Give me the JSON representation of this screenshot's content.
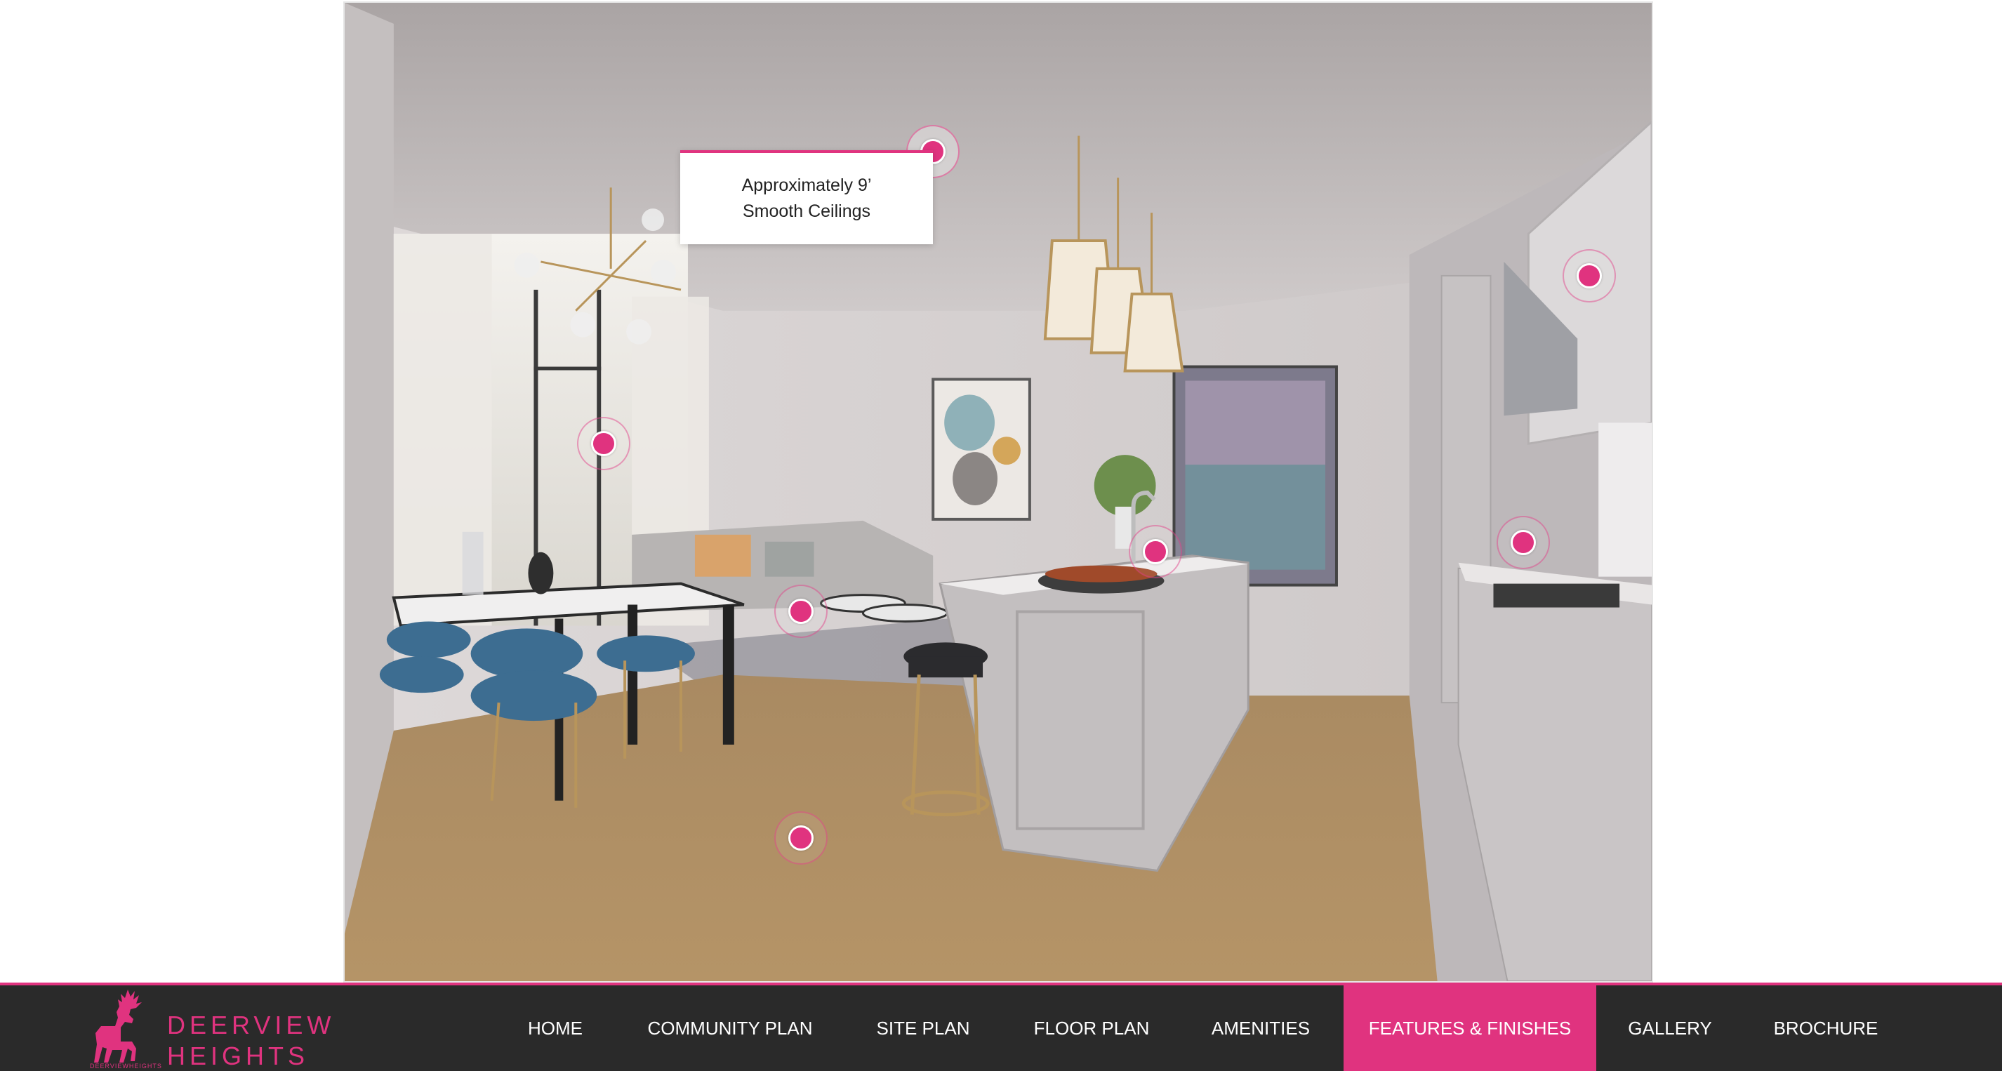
{
  "tooltip": {
    "text": "Approximately 9’\nSmooth Ceilings"
  },
  "hotspots": [
    {
      "id": "ceiling",
      "active": true
    },
    {
      "id": "cabinets"
    },
    {
      "id": "windows"
    },
    {
      "id": "faucet"
    },
    {
      "id": "backsplash"
    },
    {
      "id": "island"
    },
    {
      "id": "flooring"
    }
  ],
  "logo": {
    "line1": "DEERVIEW",
    "line2": "HEIGHTS",
    "tiny": "DEERVIEWHEIGHTS"
  },
  "nav": {
    "items": [
      {
        "label": "HOME"
      },
      {
        "label": "COMMUNITY PLAN"
      },
      {
        "label": "SITE PLAN"
      },
      {
        "label": "FLOOR PLAN"
      },
      {
        "label": "AMENITIES"
      },
      {
        "label": "FEATURES & FINISHES",
        "active": true
      },
      {
        "label": "GALLERY"
      },
      {
        "label": "BROCHURE"
      }
    ]
  },
  "colors": {
    "accent": "#e0337f",
    "navbar_bg": "#2a2a2a",
    "nav_text": "#ffffff"
  }
}
